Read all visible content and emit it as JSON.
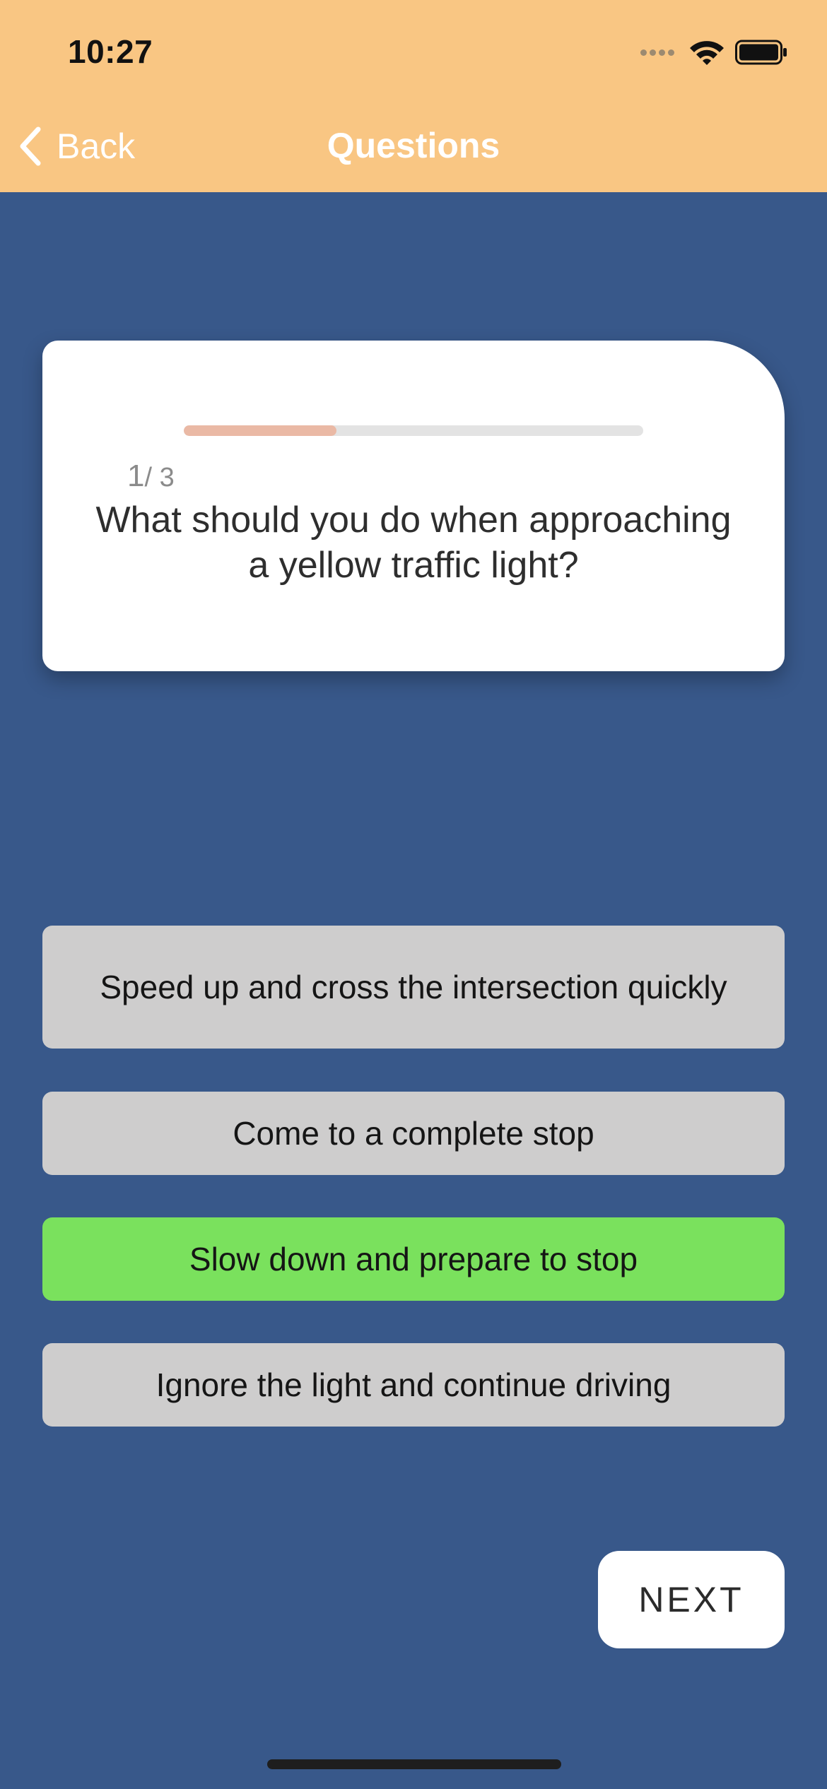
{
  "status_bar": {
    "time": "10:27",
    "icons": [
      "cellular-signal-icon",
      "wifi-icon",
      "battery-icon"
    ]
  },
  "nav": {
    "back_label": "Back",
    "title": "Questions"
  },
  "question": {
    "current": "1",
    "total": "/ 3",
    "progress": 0.333,
    "text": "What should you do when approaching a yellow traffic light?"
  },
  "answers": [
    {
      "label": "Speed up and cross the intersection quickly",
      "selected": false
    },
    {
      "label": "Come to a complete stop",
      "selected": false
    },
    {
      "label": "Slow down and prepare to stop",
      "selected": true
    },
    {
      "label": "Ignore the light and continue driving",
      "selected": false
    }
  ],
  "next_label": "NEXT",
  "colors": {
    "header": "#F9C683",
    "background": "#38588A",
    "answer_default": "#CECDCD",
    "answer_selected": "#7AE15D",
    "progress_fill": "#EAB9A5",
    "progress_track": "#E3E3E3"
  }
}
